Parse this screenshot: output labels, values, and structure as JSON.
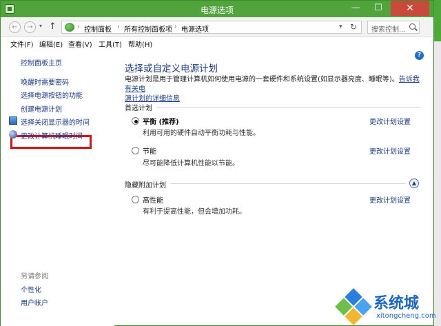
{
  "window": {
    "title": "电源选项",
    "min_symbol": "—",
    "max_symbol": "☐",
    "close_symbol": "✕"
  },
  "nav": {
    "back_symbol": "←",
    "forward_symbol": "→",
    "recent_symbol": "▾",
    "up_symbol": "↑",
    "breadcrumbs": [
      "控制面板",
      "所有控制面板项",
      "电源选项"
    ],
    "separator": "›",
    "dropdown_symbol": "▾",
    "refresh_symbol": "↻",
    "search_placeholder": "搜索控制..."
  },
  "menu": [
    "文件(F)",
    "编辑(E)",
    "查看(V)",
    "工具(T)",
    "帮助(H)"
  ],
  "sidebar": {
    "home": "控制面板主页",
    "links": [
      "唤醒时需要密码",
      "选择电源按钮的功能",
      "创建电源计划",
      "选择关闭显示器的时间",
      "更改计算机睡眠时间"
    ],
    "see_also_label": "另请参阅",
    "see_also": [
      "个性化",
      "用户帐户"
    ]
  },
  "main": {
    "help_symbol": "?",
    "title": "选择或自定义电源计划",
    "desc_line1": "电源计划是用于管理计算机如何使用电源的一套硬件和系统设置(如显示器亮度、睡眠等)。",
    "desc_link_a": "告诉我有关电",
    "desc_link_b": "源计划的详细信息",
    "preferred_label": "首选计划",
    "hidden_label": "隐藏附加计划",
    "collapse_symbol": "▲",
    "plans": [
      {
        "name": "平衡 (推荐)",
        "desc": "利用可用的硬件自动平衡功耗与性能。",
        "link": "更改计划设置",
        "checked": true
      },
      {
        "name": "节能",
        "desc": "尽可能降低计算机性能以节能。",
        "link": "更改计划设置",
        "checked": false
      },
      {
        "name": "高性能",
        "desc": "有利于提高性能，但会增加功耗。",
        "link": "更改计划设置",
        "checked": false
      }
    ]
  },
  "watermark": {
    "name": "系统城",
    "url": "xitongcheng.com"
  }
}
